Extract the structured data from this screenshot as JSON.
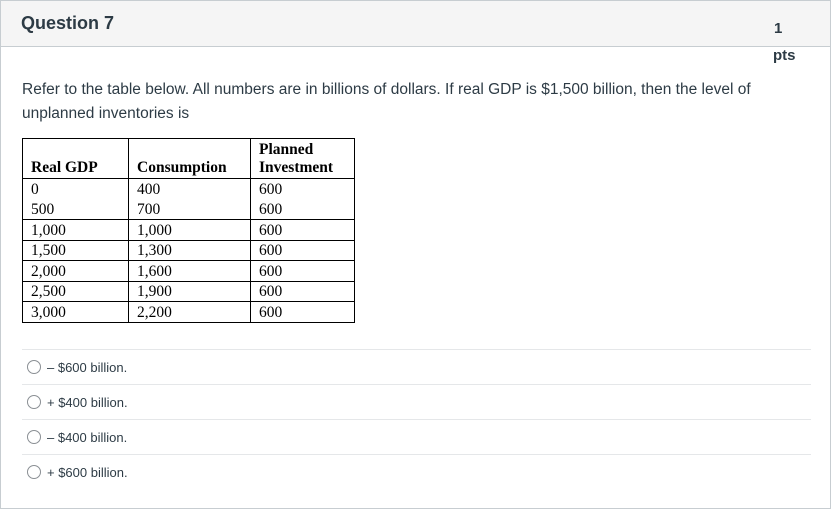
{
  "question": {
    "title": "Question 7",
    "points_value": "1",
    "points_unit": "pts",
    "text": "Refer to the table below. All numbers are in billions of dollars. If real GDP is $1,500 billion, then the level of unplanned inventories is"
  },
  "table": {
    "headers": [
      "Real GDP",
      "Consumption",
      "Planned Investment"
    ],
    "header_line1": [
      "",
      "",
      "Planned"
    ],
    "header_line2": [
      "Real GDP",
      "Consumption",
      "Investment"
    ],
    "rows": [
      [
        "0",
        "400",
        "600"
      ],
      [
        "500",
        "700",
        "600"
      ],
      [
        "1,000",
        "1,000",
        "600"
      ],
      [
        "1,500",
        "1,300",
        "600"
      ],
      [
        "2,000",
        "1,600",
        "600"
      ],
      [
        "2,500",
        "1,900",
        "600"
      ],
      [
        "3,000",
        "2,200",
        "600"
      ]
    ]
  },
  "answers": [
    {
      "label": "– $600 billion.",
      "selected": false
    },
    {
      "label": "+ $400 billion.",
      "selected": false
    },
    {
      "label": "– $400 billion.",
      "selected": false
    },
    {
      "label": "+ $600 billion.",
      "selected": false
    }
  ]
}
